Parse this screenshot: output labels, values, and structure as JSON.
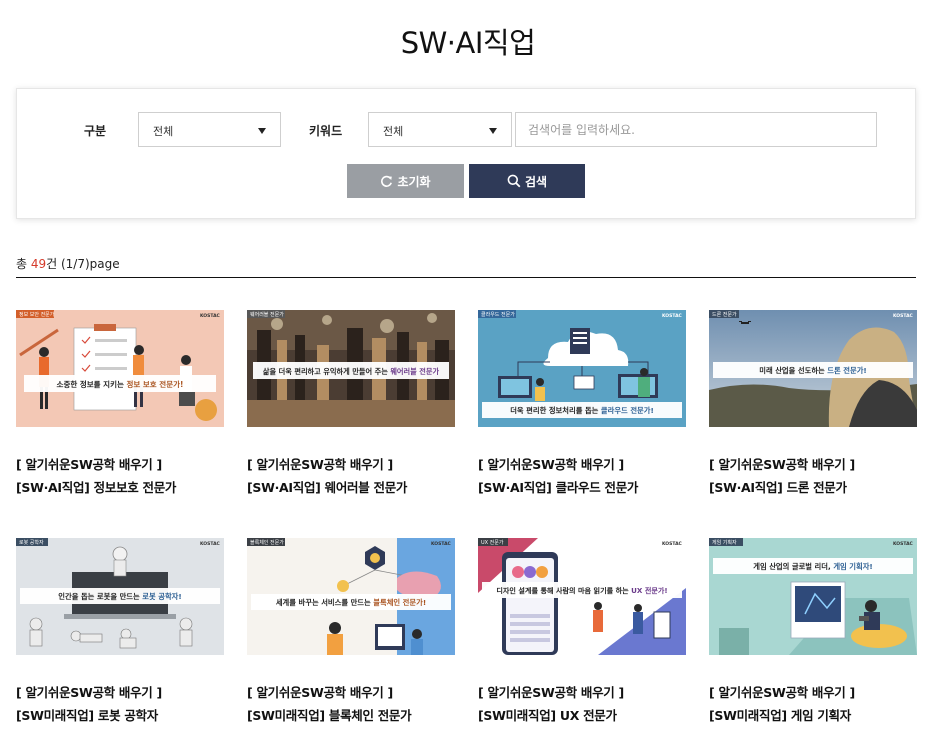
{
  "page": {
    "title": "SW·AI직업"
  },
  "filters": {
    "category_label": "구분",
    "category_value": "전체",
    "keyword_label": "키워드",
    "keyword_value": "전체",
    "search_placeholder": "검색어를 입력하세요.",
    "reset_label": "초기화",
    "search_label": "검색"
  },
  "results": {
    "prefix": "총 ",
    "count": "49",
    "suffix": "건 (1/7)page"
  },
  "colors": {
    "accent_count": "#d53a2a",
    "search_button": "#2f3a58",
    "reset_button": "#9a9ea3"
  },
  "cards": [
    {
      "series": "[ 알기쉬운SW공학 배우기 ]",
      "title": "[SW·AI직업] 정보보호 전문가",
      "badge": "정보 보안 전문가",
      "logo": "KOSTAC",
      "caption_pre": "소중한 정보를 지키는 ",
      "caption_hi": "정보 보호 전문가!",
      "caption_post": ""
    },
    {
      "series": "[ 알기쉬운SW공학 배우기 ]",
      "title": "[SW·AI직업] 웨어러블 전문가",
      "badge": "웨어러블 전문가",
      "logo": "KOSTAC",
      "caption_pre": "삶을 더욱 편리하고 유익하게 만들어 주는 ",
      "caption_hi": "웨어러블 전문가",
      "caption_post": ""
    },
    {
      "series": "[ 알기쉬운SW공학 배우기 ]",
      "title": "[SW·AI직업] 클라우드 전문가",
      "badge": "클라우드 전문가",
      "logo": "KOSTAC",
      "caption_pre": "더욱 편리한 정보처리를 돕는 ",
      "caption_hi": "클라우드 전문가!",
      "caption_post": ""
    },
    {
      "series": "[ 알기쉬운SW공학 배우기 ]",
      "title": "[SW·AI직업] 드론 전문가",
      "badge": "드론 전문가",
      "logo": "KOSTAC",
      "caption_pre": "미래 산업을 선도하는 ",
      "caption_hi": "드론 전문가!",
      "caption_post": ""
    },
    {
      "series": "[ 알기쉬운SW공학 배우기 ]",
      "title": "[SW미래직업] 로봇 공학자",
      "badge": "로봇 공학자",
      "logo": "KOSTAC",
      "caption_pre": "인간을 돕는 로봇을 만드는 ",
      "caption_hi": "로봇 공학자!",
      "caption_post": ""
    },
    {
      "series": "[ 알기쉬운SW공학 배우기 ]",
      "title": "[SW미래직업] 블록체인 전문가",
      "badge": "블록체인 전문가",
      "logo": "KOSTAC",
      "caption_pre": "세계를 바꾸는 서비스를 만드는 ",
      "caption_hi": "블록체인 전문가!",
      "caption_post": ""
    },
    {
      "series": "[ 알기쉬운SW공학 배우기 ]",
      "title": "[SW미래직업] UX 전문가",
      "badge": "UX 전문가",
      "logo": "KOSTAC",
      "caption_pre": "디자인 설계를 통해 사람의 마음 읽기를 하는 ",
      "caption_hi": "UX 전문가!",
      "caption_post": ""
    },
    {
      "series": "[ 알기쉬운SW공학 배우기 ]",
      "title": "[SW미래직업] 게임 기획자",
      "badge": "게임 기획자",
      "logo": "KOSTAC",
      "caption_pre": "게임 산업의 글로벌 리더, ",
      "caption_hi": "게임 기획자!",
      "caption_post": ""
    }
  ]
}
